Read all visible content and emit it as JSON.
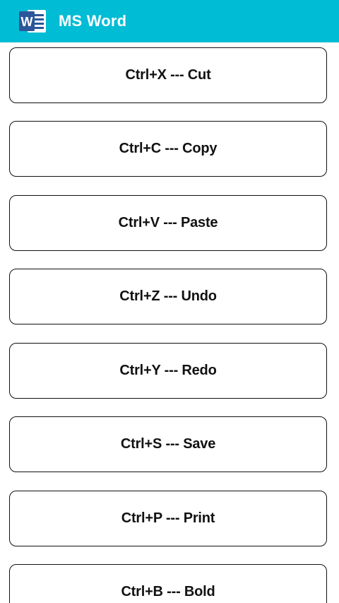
{
  "app": {
    "title": "MS Word",
    "icon": "ms-word-logo-icon",
    "logo_letter": "W",
    "bar_color": "#00BCD4",
    "logo_color": "#2B579A"
  },
  "shortcuts": [
    {
      "label": "Ctrl+X --- Cut"
    },
    {
      "label": "Ctrl+C --- Copy"
    },
    {
      "label": "Ctrl+V --- Paste"
    },
    {
      "label": "Ctrl+Z --- Undo"
    },
    {
      "label": "Ctrl+Y --- Redo"
    },
    {
      "label": "Ctrl+S --- Save"
    },
    {
      "label": "Ctrl+P --- Print"
    },
    {
      "label": "Ctrl+B --- Bold"
    }
  ]
}
